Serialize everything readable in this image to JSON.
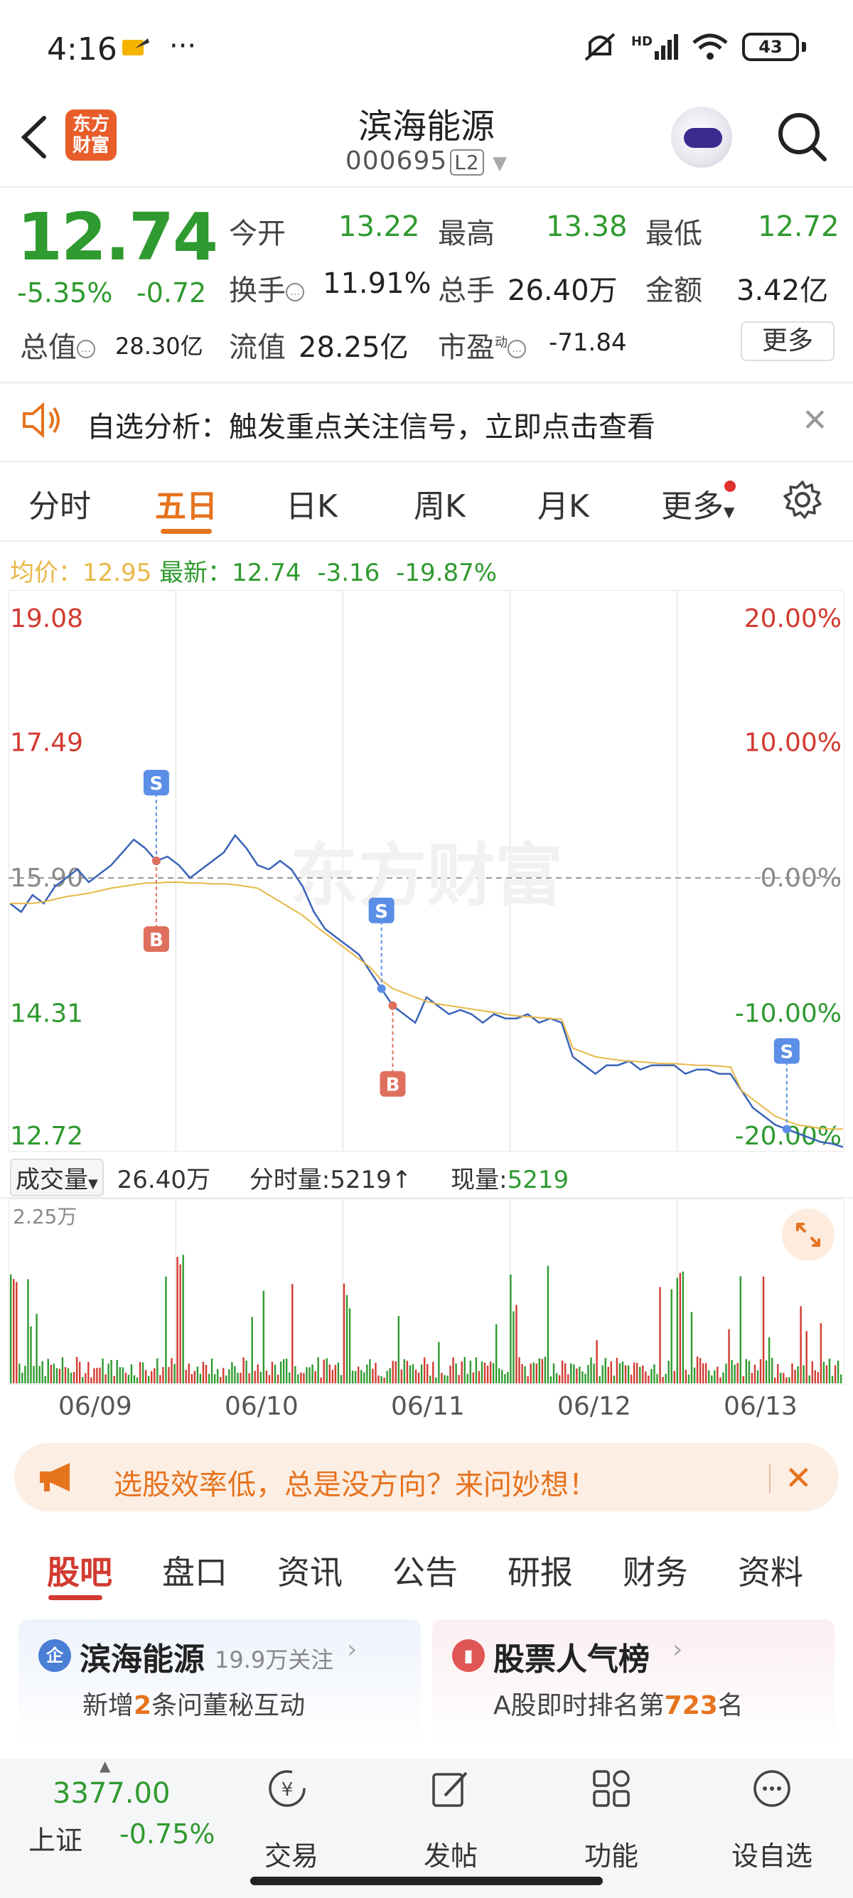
{
  "status_bar": {
    "time": "4:16",
    "dots": "···",
    "signal_label": "HD",
    "battery": "43"
  },
  "header": {
    "title": "滨海能源",
    "code": "000695",
    "badge": "L2",
    "logo_line1": "东方",
    "logo_line2": "财富"
  },
  "quote": {
    "price": "12.74",
    "change_pct": "-5.35%",
    "change": "-0.72",
    "open_label": "今开",
    "open": "13.22",
    "high_label": "最高",
    "high": "13.38",
    "low_label": "最低",
    "low": "12.72",
    "turnover_label": "换手",
    "turnover": "11.91%",
    "volume_label": "总手",
    "volume": "26.40万",
    "amount_label": "金额",
    "amount": "3.42亿",
    "mktcap_label": "总值",
    "mktcap": "28.30亿",
    "float_label": "流值",
    "float": "28.25亿",
    "pe_label": "市盈",
    "pe_sup": "动",
    "pe": "-71.84",
    "more": "更多"
  },
  "notice": {
    "text": "自选分析：触发重点关注信号，立即点击查看"
  },
  "tabs": [
    "分时",
    "五日",
    "日K",
    "周K",
    "月K",
    "更多"
  ],
  "active_tab": "五日",
  "avg_bar": {
    "avg_label": "均价：",
    "avg": "12.95",
    "latest_label": "最新：",
    "latest": "12.74",
    "change": "-3.16",
    "change_pct": "-19.87%"
  },
  "chart_data": {
    "type": "line",
    "left_ticks": [
      "19.08",
      "17.49",
      "15.90",
      "14.31",
      "12.72"
    ],
    "right_ticks": [
      "20.00%",
      "10.00%",
      "0.00%",
      "-10.00%",
      "-20.00%"
    ],
    "ylim": [
      12.72,
      19.08
    ],
    "base": 15.9,
    "x": [
      "06/09",
      "06/10",
      "06/11",
      "06/12",
      "06/13"
    ],
    "watermark": "东方财富",
    "series": [
      {
        "name": "price",
        "color": "#3a63b8",
        "values": [
          15.6,
          15.5,
          15.7,
          15.6,
          15.8,
          15.9,
          16.0,
          15.85,
          15.95,
          16.05,
          16.2,
          16.35,
          16.25,
          16.1,
          16.15,
          16.05,
          15.9,
          16.0,
          16.1,
          16.2,
          16.4,
          16.25,
          16.05,
          16.0,
          16.1,
          16.0,
          15.8,
          15.5,
          15.3,
          15.2,
          15.1,
          15.0,
          14.8,
          14.6,
          14.4,
          14.3,
          14.2,
          14.5,
          14.4,
          14.3,
          14.35,
          14.3,
          14.2,
          14.3,
          14.25,
          14.25,
          14.3,
          14.2,
          14.25,
          14.2,
          13.8,
          13.7,
          13.6,
          13.7,
          13.7,
          13.75,
          13.65,
          13.7,
          13.7,
          13.7,
          13.6,
          13.65,
          13.65,
          13.6,
          13.6,
          13.4,
          13.2,
          13.1,
          13.0,
          12.95,
          12.9,
          12.85,
          12.8,
          12.78,
          12.74
        ]
      },
      {
        "name": "avg",
        "color": "#e8b848",
        "values": [
          15.6,
          15.6,
          15.6,
          15.62,
          15.65,
          15.68,
          15.7,
          15.72,
          15.75,
          15.78,
          15.8,
          15.82,
          15.84,
          15.84,
          15.85,
          15.85,
          15.84,
          15.84,
          15.83,
          15.83,
          15.82,
          15.8,
          15.78,
          15.7,
          15.62,
          15.54,
          15.46,
          15.35,
          15.25,
          15.15,
          15.05,
          14.95,
          14.85,
          14.7,
          14.6,
          14.55,
          14.5,
          14.45,
          14.42,
          14.4,
          14.38,
          14.36,
          14.34,
          14.32,
          14.3,
          14.28,
          14.27,
          14.26,
          14.25,
          14.24,
          13.9,
          13.85,
          13.8,
          13.78,
          13.76,
          13.75,
          13.74,
          13.73,
          13.72,
          13.72,
          13.71,
          13.7,
          13.7,
          13.69,
          13.68,
          13.4,
          13.3,
          13.2,
          13.1,
          13.05,
          13.0,
          12.98,
          12.96,
          12.95,
          12.95
        ]
      }
    ],
    "markers": [
      {
        "type": "S",
        "index": 13
      },
      {
        "type": "B",
        "index": 13
      },
      {
        "type": "S",
        "index": 33
      },
      {
        "type": "B",
        "index": 34
      },
      {
        "type": "S",
        "index": 69
      }
    ]
  },
  "volume_bar": {
    "label": "成交量",
    "total": "26.40万",
    "tick_label": "分时量:",
    "tick": "5219",
    "now_label": "现量:",
    "now": "5219",
    "max": "2.25万"
  },
  "banner": {
    "text": "选股效率低，总是没方向？来问妙想！"
  },
  "bottom_tabs": [
    "股吧",
    "盘口",
    "资讯",
    "公告",
    "研报",
    "财务",
    "资料"
  ],
  "cards": [
    {
      "title": "滨海能源",
      "sub": "19.9万关注",
      "line_pre": "新增",
      "line_num": "2",
      "line_post": "条问董秘互动",
      "icon": "企"
    },
    {
      "title": "股票人气榜",
      "line_pre": "A股即时排名第",
      "line_num": "723",
      "line_post": "名"
    }
  ],
  "footer": {
    "index_value": "3377.00",
    "index_name": "上证",
    "index_change": "-0.75%",
    "nav": [
      "交易",
      "发帖",
      "功能",
      "设自选"
    ]
  }
}
